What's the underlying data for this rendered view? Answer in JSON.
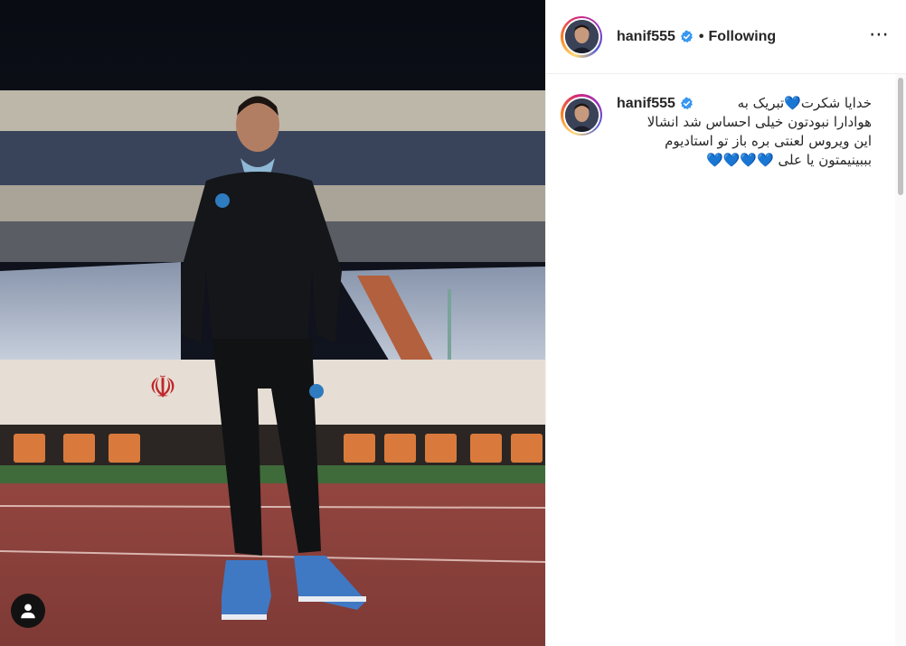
{
  "post": {
    "username": "hanif555",
    "follow_label": "Following",
    "separator": "•",
    "more_icon": "⋯",
    "caption_lines": [
      "خدایا شکرت💙تبریک به",
      "هوادارا نبودتون خیلی احساس شد انشالا",
      "این ویروس لعنتی بره باز تو استادیوم",
      "بببینیمتون یا علی 💙💙💙💙"
    ]
  },
  "icons": {
    "verified": "verified-badge-icon",
    "user_tag": "user-tag-icon",
    "more": "more-options-icon"
  },
  "colors": {
    "verified_blue": "#3897f0",
    "heart_blue": "#1da1f2",
    "track_red": "#8c3f3a",
    "seat_blue": "#6e7f9c"
  }
}
